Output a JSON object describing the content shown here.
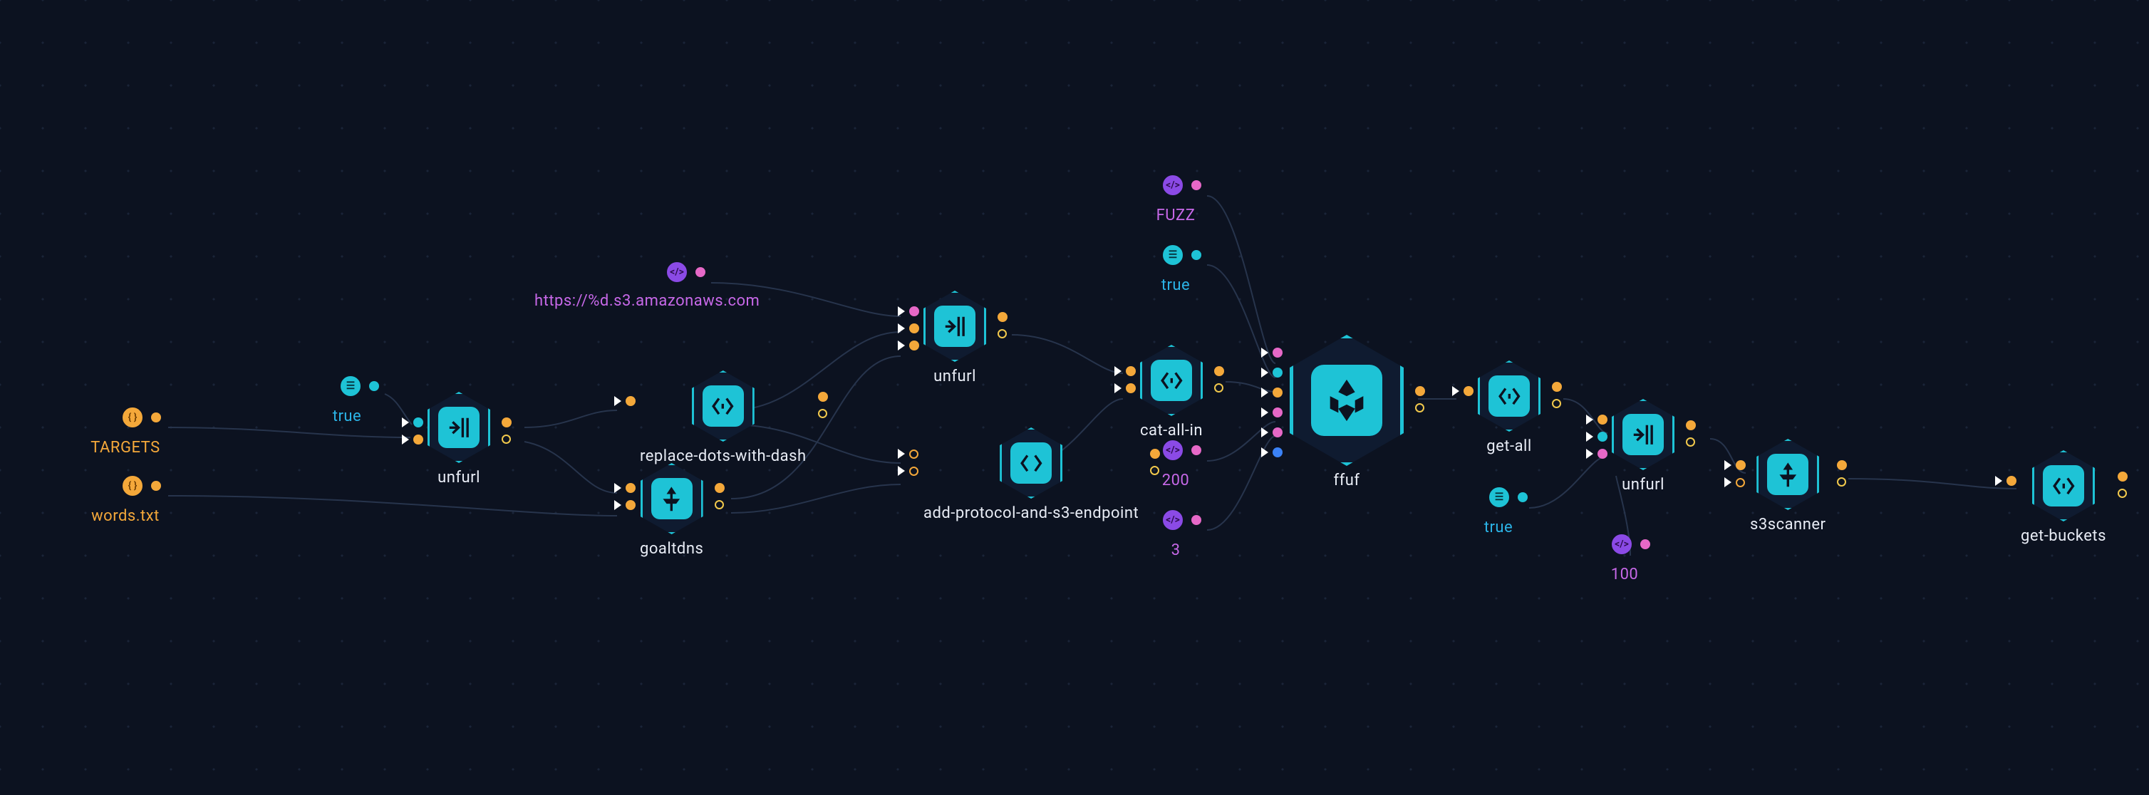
{
  "inputs": {
    "targets": "TARGETS",
    "words": "words.txt"
  },
  "params": {
    "unfurl1_apex": "true",
    "s3_template": "https://%d.s3.amazonaws.com",
    "fuzz_keyword": "FUZZ",
    "ffuf_silent": "true",
    "ffuf_mc": "200",
    "ffuf_t": "3",
    "getall_domains": "true",
    "unfurl3_limit": "100"
  },
  "nodes": {
    "unfurl1": "unfurl",
    "replace": "replace-dots-with-dash",
    "goaltdns": "goaltdns",
    "unfurl2": "unfurl",
    "addproto": "add-protocol-and-s3-endpoint",
    "catall": "cat-all-in",
    "ffuf": "ffuf",
    "getall": "get-all",
    "unfurl3": "unfurl",
    "s3scanner": "s3scanner",
    "getbuckets": "get-buckets"
  },
  "colors": {
    "bg": "#0c1220",
    "accent": "#1ec3d6",
    "orange": "#f4a83a",
    "purple": "#c768e8",
    "pink": "#e668c7",
    "edge": "#27344c"
  }
}
